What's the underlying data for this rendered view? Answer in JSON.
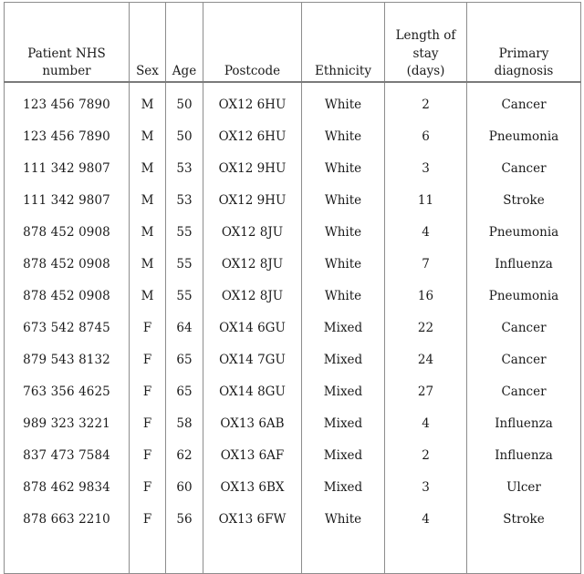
{
  "table": {
    "name": "patient-records-table",
    "columns": [
      {
        "key": "nhs",
        "label_lines": [
          "Patient NHS",
          "number"
        ]
      },
      {
        "key": "sex",
        "label_lines": [
          "Sex"
        ]
      },
      {
        "key": "age",
        "label_lines": [
          "Age"
        ]
      },
      {
        "key": "postcode",
        "label_lines": [
          "Postcode"
        ]
      },
      {
        "key": "ethnicity",
        "label_lines": [
          "Ethnicity"
        ]
      },
      {
        "key": "los",
        "label_lines": [
          "Length of",
          "stay",
          "(days)"
        ]
      },
      {
        "key": "diagnosis",
        "label_lines": [
          "Primary",
          "diagnosis"
        ]
      }
    ],
    "headers": {
      "nhs_line1": "Patient NHS",
      "nhs_line2": "number",
      "sex": "Sex",
      "age": "Age",
      "postcode": "Postcode",
      "ethnicity": "Ethnicity",
      "los_line1": "Length of",
      "los_line2": "stay",
      "los_line3": "(days)",
      "diagnosis_line1": "Primary",
      "diagnosis_line2": "diagnosis"
    },
    "rows": [
      {
        "nhs": "123 456 7890",
        "sex": "M",
        "age": "50",
        "postcode": "OX12 6HU",
        "ethnicity": "White",
        "los": "2",
        "diagnosis": "Cancer"
      },
      {
        "nhs": "123 456 7890",
        "sex": "M",
        "age": "50",
        "postcode": "OX12 6HU",
        "ethnicity": "White",
        "los": "6",
        "diagnosis": "Pneumonia"
      },
      {
        "nhs": "111 342 9807",
        "sex": "M",
        "age": "53",
        "postcode": "OX12 9HU",
        "ethnicity": "White",
        "los": "3",
        "diagnosis": "Cancer"
      },
      {
        "nhs": "111 342 9807",
        "sex": "M",
        "age": "53",
        "postcode": "OX12 9HU",
        "ethnicity": "White",
        "los": "11",
        "diagnosis": "Stroke"
      },
      {
        "nhs": "878 452 0908",
        "sex": "M",
        "age": "55",
        "postcode": "OX12 8JU",
        "ethnicity": "White",
        "los": "4",
        "diagnosis": "Pneumonia"
      },
      {
        "nhs": "878 452 0908",
        "sex": "M",
        "age": "55",
        "postcode": "OX12 8JU",
        "ethnicity": "White",
        "los": "7",
        "diagnosis": "Influenza"
      },
      {
        "nhs": "878 452 0908",
        "sex": "M",
        "age": "55",
        "postcode": "OX12 8JU",
        "ethnicity": "White",
        "los": "16",
        "diagnosis": "Pneumonia"
      },
      {
        "nhs": "673 542 8745",
        "sex": "F",
        "age": "64",
        "postcode": "OX14 6GU",
        "ethnicity": "Mixed",
        "los": "22",
        "diagnosis": "Cancer"
      },
      {
        "nhs": "879 543 8132",
        "sex": "F",
        "age": "65",
        "postcode": "OX14 7GU",
        "ethnicity": "Mixed",
        "los": "24",
        "diagnosis": "Cancer"
      },
      {
        "nhs": "763 356 4625",
        "sex": "F",
        "age": "65",
        "postcode": "OX14 8GU",
        "ethnicity": "Mixed",
        "los": "27",
        "diagnosis": "Cancer"
      },
      {
        "nhs": "989 323 3221",
        "sex": "F",
        "age": "58",
        "postcode": "OX13 6AB",
        "ethnicity": "Mixed",
        "los": "4",
        "diagnosis": "Influenza"
      },
      {
        "nhs": "837 473 7584",
        "sex": "F",
        "age": "62",
        "postcode": "OX13 6AF",
        "ethnicity": "Mixed",
        "los": "2",
        "diagnosis": "Influenza"
      },
      {
        "nhs": "878 462 9834",
        "sex": "F",
        "age": "60",
        "postcode": "OX13 6BX",
        "ethnicity": "Mixed",
        "los": "3",
        "diagnosis": "Ulcer"
      },
      {
        "nhs": "878 663 2210",
        "sex": "F",
        "age": "56",
        "postcode": "OX13 6FW",
        "ethnicity": "White",
        "los": "4",
        "diagnosis": "Stroke"
      }
    ],
    "trailing_empty_row": {
      "nhs": "",
      "sex": "",
      "age": "",
      "postcode": "",
      "ethnicity": "",
      "los": "",
      "diagnosis": ""
    }
  },
  "colors": {
    "border": "#8d8d8d",
    "header_rule": "#7a7a7a",
    "text": "#1a1a1a",
    "background": "#ffffff"
  }
}
